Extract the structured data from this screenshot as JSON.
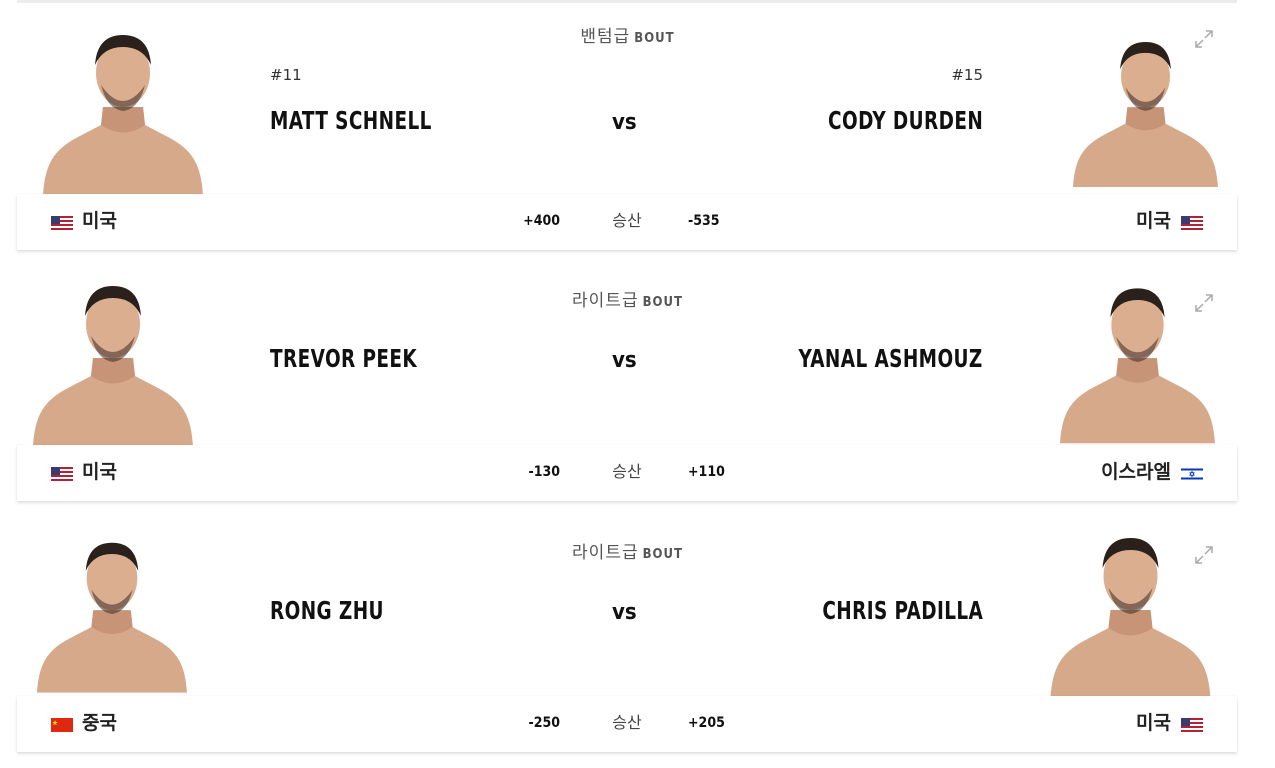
{
  "colors": {
    "accent": "#d20a0a",
    "text": "#191919",
    "muted": "#555555"
  },
  "bouts": [
    {
      "weight_class": "밴텀급",
      "bout_label": "BOUT",
      "red": {
        "rank": "#11",
        "name": "MATT SCHNELL",
        "country": "미국",
        "flag": "us-flag",
        "odds": "+400"
      },
      "blue": {
        "rank": "#15",
        "name": "CODY DURDEN",
        "country": "미국",
        "flag": "us-flag",
        "odds": "-535"
      },
      "vs": "vs",
      "odds_label": "승산"
    },
    {
      "weight_class": "라이트급",
      "bout_label": "BOUT",
      "red": {
        "rank": "",
        "name": "TREVOR PEEK",
        "country": "미국",
        "flag": "us-flag",
        "odds": "-130"
      },
      "blue": {
        "rank": "",
        "name": "YANAL ASHMOUZ",
        "country": "이스라엘",
        "flag": "israel-flag",
        "odds": "+110"
      },
      "vs": "vs",
      "odds_label": "승산"
    },
    {
      "weight_class": "라이트급",
      "bout_label": "BOUT",
      "red": {
        "rank": "",
        "name": "RONG ZHU",
        "country": "중국",
        "flag": "china-flag",
        "odds": "-250"
      },
      "blue": {
        "rank": "",
        "name": "CHRIS PADILLA",
        "country": "미국",
        "flag": "us-flag",
        "odds": "+205"
      },
      "vs": "vs",
      "odds_label": "승산"
    }
  ]
}
